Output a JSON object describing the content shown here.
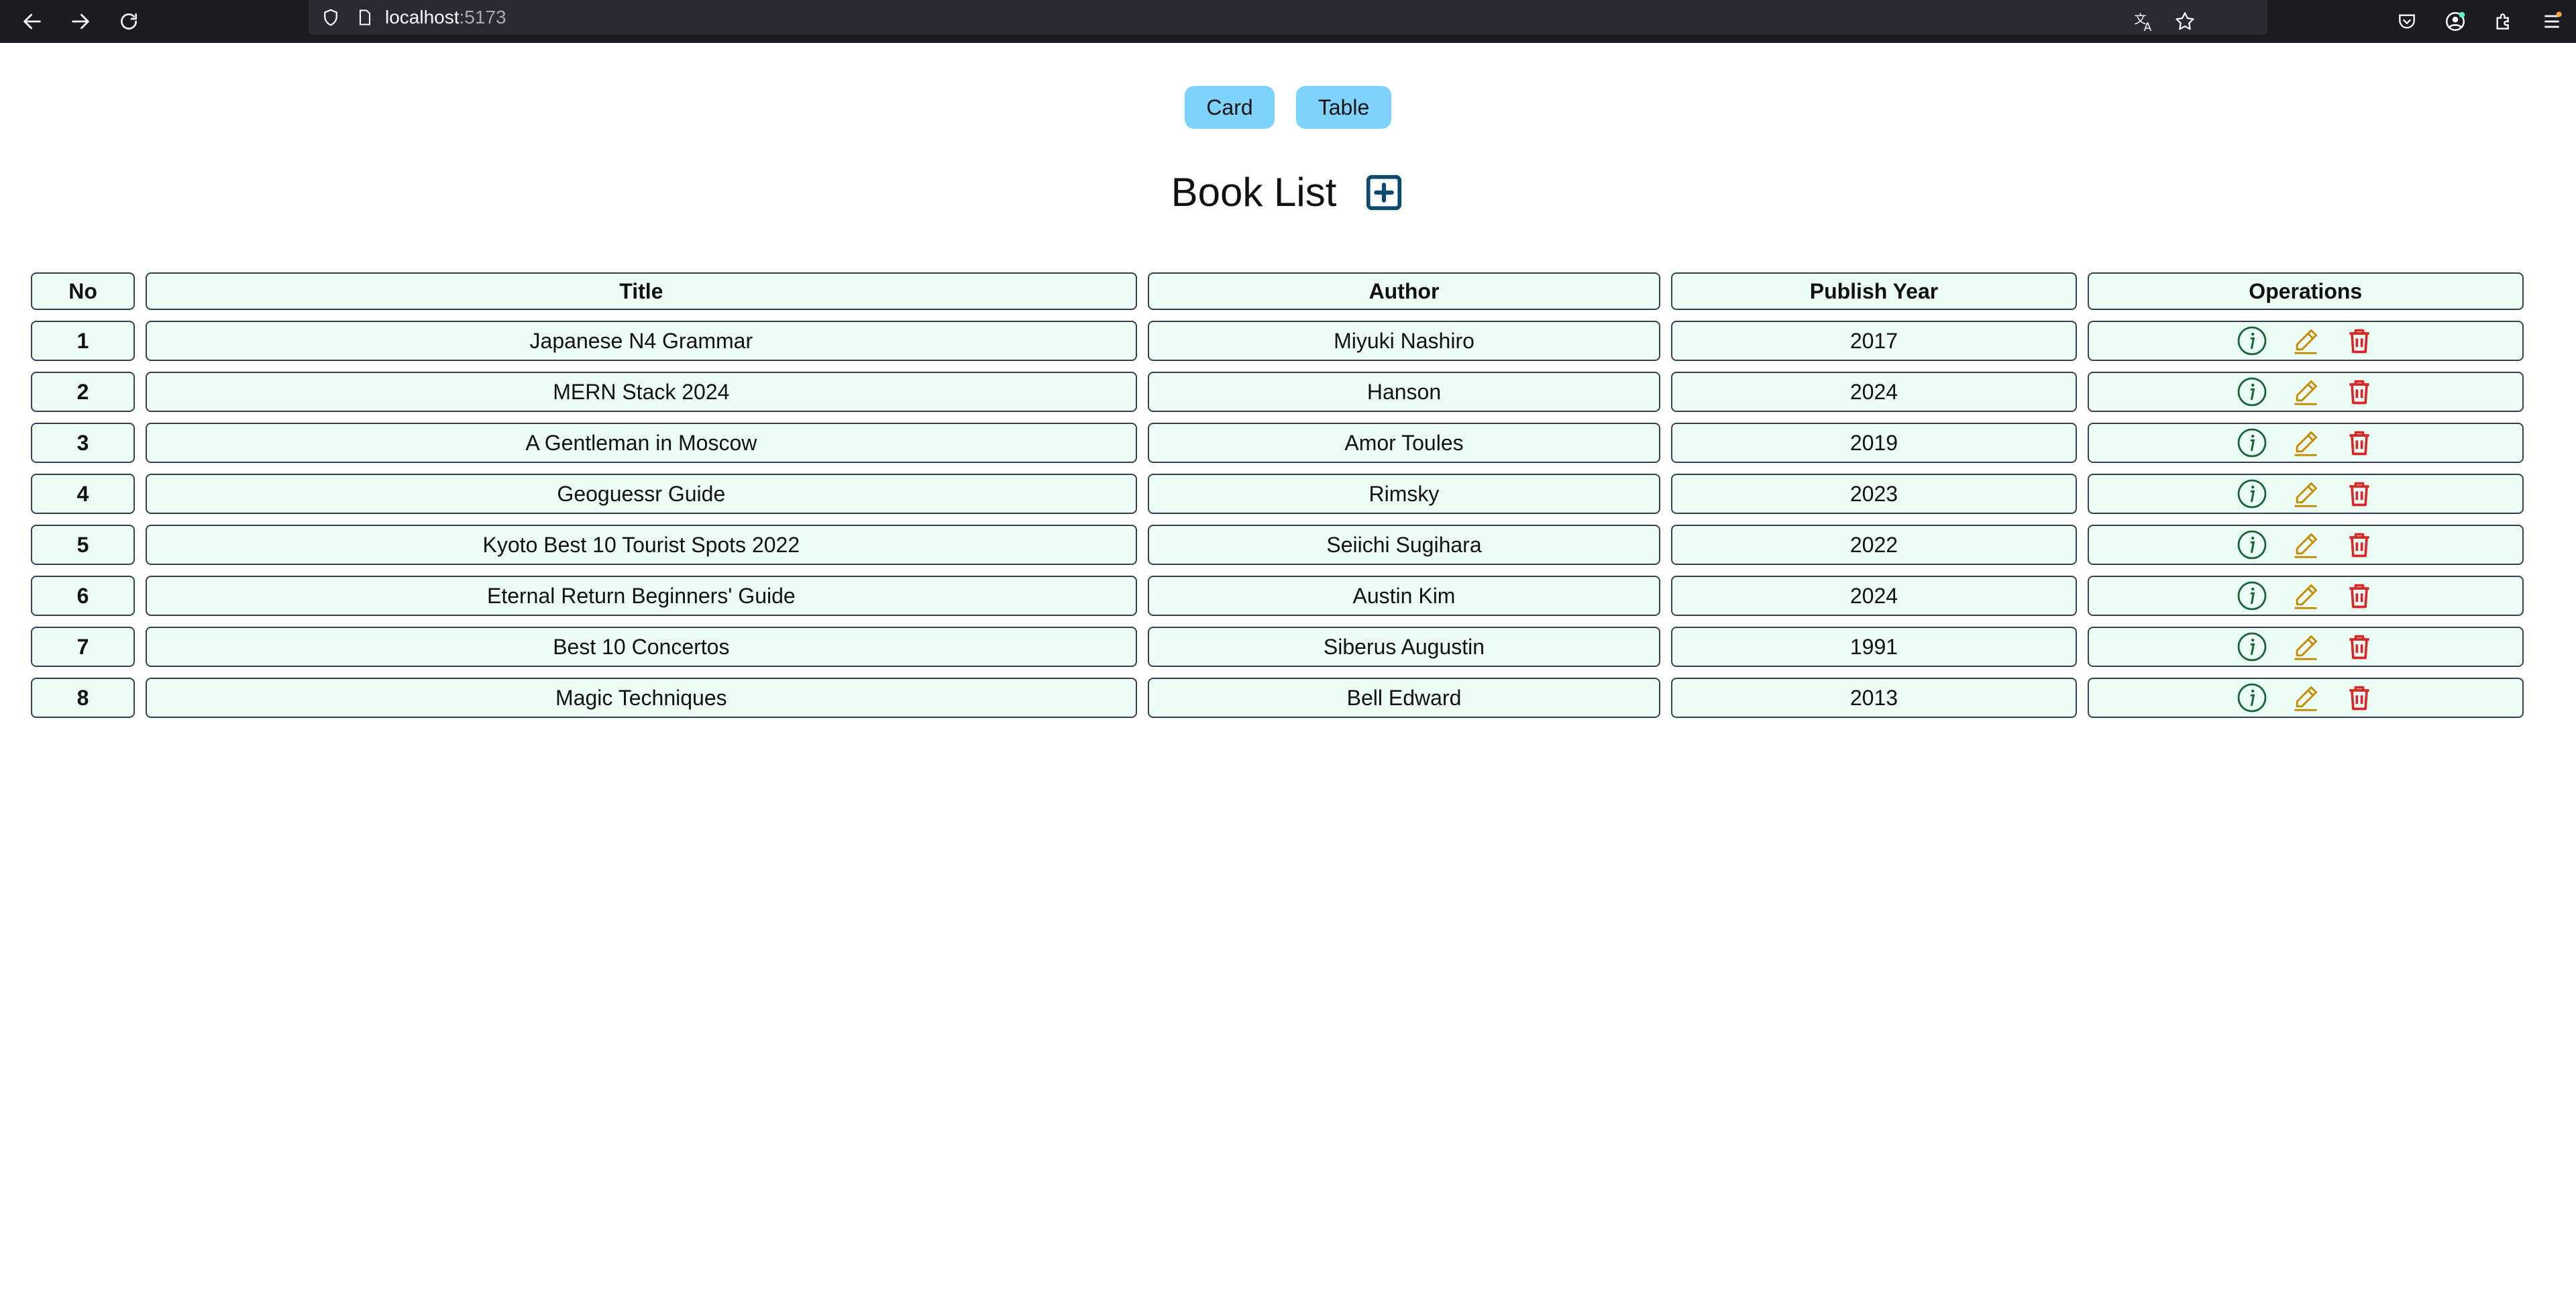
{
  "browser": {
    "url_host": "localhost",
    "url_port": ":5173"
  },
  "view_toggle": {
    "card_label": "Card",
    "table_label": "Table"
  },
  "page": {
    "title": "Book List"
  },
  "table": {
    "headers": {
      "no": "No",
      "title": "Title",
      "author": "Author",
      "year": "Publish Year",
      "operations": "Operations"
    },
    "rows": [
      {
        "no": "1",
        "title": "Japanese N4 Grammar",
        "author": "Miyuki Nashiro",
        "year": "2017"
      },
      {
        "no": "2",
        "title": "MERN Stack 2024",
        "author": "Hanson",
        "year": "2024"
      },
      {
        "no": "3",
        "title": "A Gentleman in Moscow",
        "author": "Amor Toules",
        "year": "2019"
      },
      {
        "no": "4",
        "title": "Geoguessr Guide",
        "author": "Rimsky",
        "year": "2023"
      },
      {
        "no": "5",
        "title": "Kyoto Best 10 Tourist Spots 2022",
        "author": "Seiichi Sugihara",
        "year": "2022"
      },
      {
        "no": "6",
        "title": "Eternal Return Beginners' Guide",
        "author": "Austin Kim",
        "year": "2024"
      },
      {
        "no": "7",
        "title": "Best 10 Concertos",
        "author": "Siberus Augustin",
        "year": "1991"
      },
      {
        "no": "8",
        "title": "Magic Techniques",
        "author": "Bell Edward",
        "year": "2013"
      }
    ]
  },
  "icons": {
    "add": "plus-square-icon",
    "info": "info-circle-icon",
    "edit": "pencil-icon",
    "delete": "trash-icon"
  },
  "colors": {
    "toggle_bg": "#7dd3fc",
    "cell_bg": "#ecfdf5",
    "add_icon": "#0c4a6e",
    "info_icon": "#166534",
    "edit_icon": "#ca8a04",
    "delete_icon": "#dc2626"
  }
}
